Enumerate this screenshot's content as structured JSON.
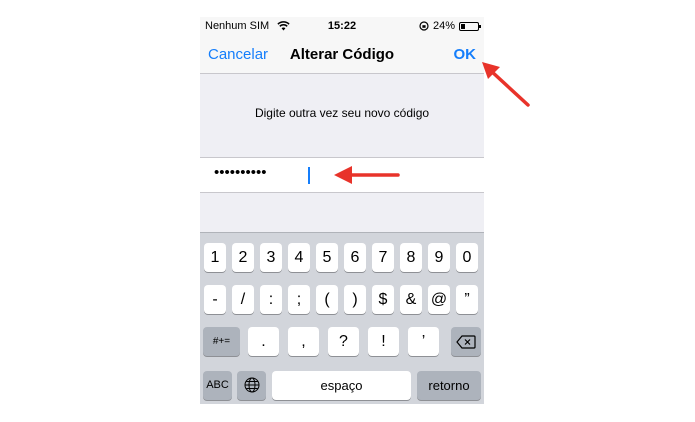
{
  "status_bar": {
    "carrier": "Nenhum SIM",
    "time": "15:22",
    "battery": "24%",
    "battery_level": 0.24
  },
  "nav": {
    "cancel_label": "Cancelar",
    "title": "Alterar Código",
    "ok_label": "OK"
  },
  "prompt_text": "Digite outra vez seu novo código",
  "passcode": {
    "masked_value": "••••••••••"
  },
  "keyboard": {
    "row1": [
      "1",
      "2",
      "3",
      "4",
      "5",
      "6",
      "7",
      "8",
      "9",
      "0"
    ],
    "row2": [
      "-",
      "/",
      ":",
      ";",
      "(",
      ")",
      "$",
      "&",
      "@",
      "”"
    ],
    "row3_mode": "#+=",
    "row3": [
      ".",
      ",",
      "?",
      "!",
      "’"
    ],
    "abc_label": "ABC",
    "space_label": "espaço",
    "return_label": "retorno"
  },
  "colors": {
    "accent": "#157efb",
    "annotation_arrow": "#e8332a"
  }
}
